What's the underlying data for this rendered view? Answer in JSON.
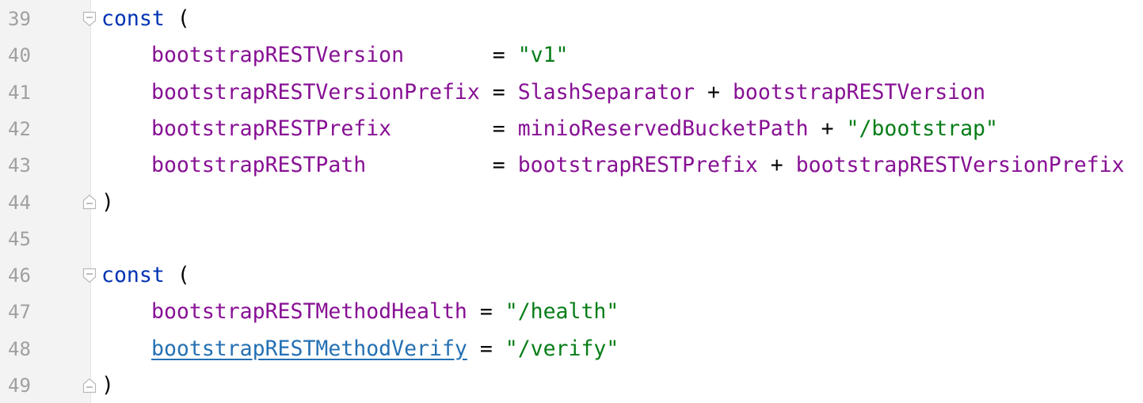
{
  "editor": {
    "lines": [
      {
        "num": "39",
        "kw": "const",
        "rest": " ("
      },
      {
        "num": "40",
        "name": "bootstrapRESTVersion",
        "eq": "       = ",
        "val1": "\"v1\""
      },
      {
        "num": "41",
        "name": "bootstrapRESTVersionPrefix",
        "eq": " = ",
        "val1": "SlashSeparator",
        "plus": " + ",
        "val2": "bootstrapRESTVersion"
      },
      {
        "num": "42",
        "name": "bootstrapRESTPrefix",
        "eq": "        = ",
        "val1": "minioReservedBucketPath",
        "plus": " + ",
        "val2": "\"/bootstrap\""
      },
      {
        "num": "43",
        "name": "bootstrapRESTPath",
        "eq": "          = ",
        "val1": "bootstrapRESTPrefix",
        "plus": " + ",
        "val2": "bootstrapRESTVersionPrefix"
      },
      {
        "num": "44",
        "close": ")"
      },
      {
        "num": "45"
      },
      {
        "num": "46",
        "kw": "const",
        "rest": " ("
      },
      {
        "num": "47",
        "name": "bootstrapRESTMethodHealth",
        "eq": " = ",
        "val1": "\"/health\""
      },
      {
        "num": "48",
        "name": "bootstrapRESTMethodVerify",
        "eq": " = ",
        "val1": "\"/verify\""
      },
      {
        "num": "49",
        "close": ")"
      }
    ]
  }
}
